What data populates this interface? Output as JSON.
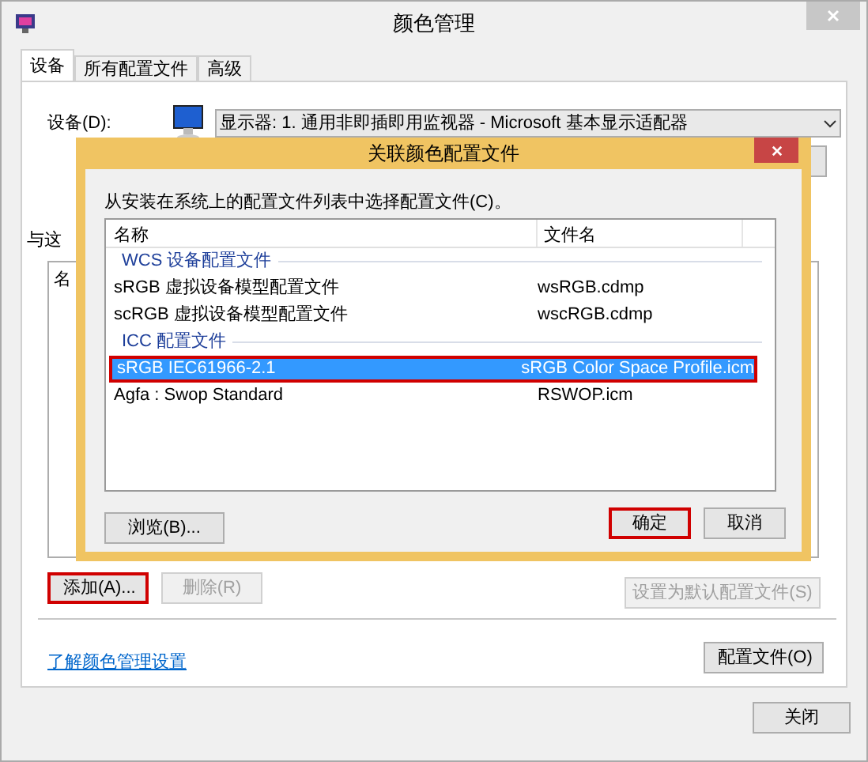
{
  "window": {
    "title": "颜色管理"
  },
  "tabs": [
    {
      "label": "设备",
      "selected": true
    },
    {
      "label": "所有配置文件",
      "selected": false
    },
    {
      "label": "高级",
      "selected": false
    }
  ],
  "device": {
    "label": "设备(D):",
    "value": "显示器: 1. 通用非即插即用监视器 - Microsoft 基本显示适配器"
  },
  "partial_label": "与这",
  "background_list": {
    "column_1": "名"
  },
  "main_buttons": [
    {
      "label": "添加(A)...",
      "disabled": false,
      "highlighted": true
    },
    {
      "label": "删除(R)",
      "disabled": true,
      "highlighted": false
    },
    {
      "label": "设置为默认配置文件(S)",
      "disabled": true,
      "highlighted": false
    }
  ],
  "link": "了解颜色管理设置",
  "profiles_button": "配置文件(O)",
  "close_button": "关闭",
  "dialog": {
    "title": "关联颜色配置文件",
    "instruction": "从安装在系统上的配置文件列表中选择配置文件(C)。",
    "columns": [
      "名称",
      "文件名"
    ],
    "groups": [
      {
        "name": "WCS 设备配置文件",
        "rows": [
          {
            "name": "sRGB 虚拟设备模型配置文件",
            "file": "wsRGB.cdmp",
            "selected": false,
            "highlighted": false
          },
          {
            "name": "scRGB 虚拟设备模型配置文件",
            "file": "wscRGB.cdmp",
            "selected": false,
            "highlighted": false
          }
        ]
      },
      {
        "name": "ICC 配置文件",
        "rows": [
          {
            "name": "sRGB IEC61966-2.1",
            "file": "sRGB Color Space Profile.icm",
            "selected": true,
            "highlighted": true
          },
          {
            "name": "Agfa : Swop Standard",
            "file": "RSWOP.icm",
            "selected": false,
            "highlighted": false
          }
        ]
      }
    ],
    "browse_button": "浏览(B)...",
    "buttons": [
      {
        "label": "确定",
        "highlighted": true
      },
      {
        "label": "取消",
        "highlighted": false
      }
    ]
  }
}
